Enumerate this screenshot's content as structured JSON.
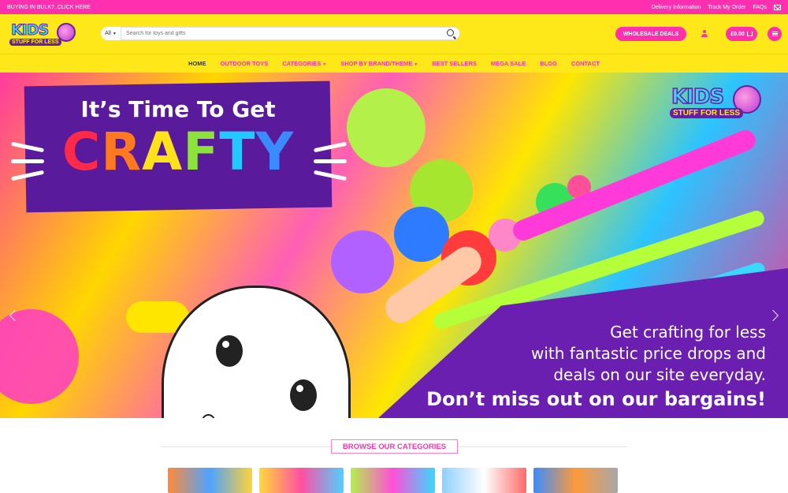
{
  "topbar": {
    "promo": "BUYING IN BULK?..CLICK HERE",
    "links": [
      "Delivery Information",
      "Track My Order",
      "FAQs"
    ],
    "mail_icon": "mail-icon"
  },
  "header": {
    "logo_kids": "KIDS",
    "logo_sub": "STUFF FOR LESS",
    "search_category": "All",
    "search_placeholder": "Search for toys and gifts",
    "wholesale": "WHOLESALE DEALS",
    "cart_total": "£0.00"
  },
  "nav": {
    "items": [
      "HOME",
      "OUTDOOR TOYS",
      "CATEGORIES",
      "SHOP BY BRAND/THEME",
      "BEST SELLERS",
      "MEGA SALE",
      "BLOG",
      "CONTACT"
    ]
  },
  "hero": {
    "title_line1": "It’s Time To Get",
    "title_word": "CRAFTY",
    "promo_lines": [
      "Get crafting for less",
      "with fantastic price drops and",
      "deals on our site everyday."
    ],
    "promo_bold": "Don’t miss out on our bargains!",
    "logo_kids": "KIDS",
    "logo_sub": "STUFF FOR LESS",
    "letter_colors": [
      "#ff2a4a",
      "#ff7a1f",
      "#ffe21a",
      "#8ce33a",
      "#22c8ff",
      "#3a8bff"
    ]
  },
  "browse": {
    "title": "BROWSE OUR CATEGORIES"
  },
  "colors": {
    "pink": "#ff2fb0",
    "yellow": "#ffe81a",
    "purple": "#6a1fb0"
  }
}
